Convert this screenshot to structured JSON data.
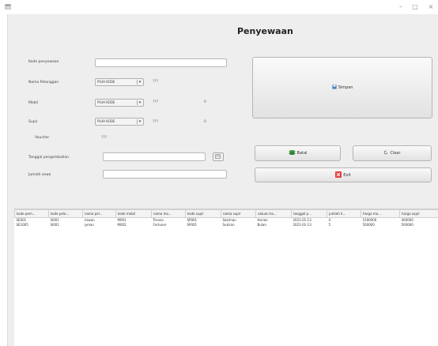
{
  "window": {
    "minimize": "–",
    "maximize": "□",
    "close": "×"
  },
  "form": {
    "title": "Penyewaan",
    "kode_penyewaan": {
      "label": "Kode penyewaan",
      "value": ""
    },
    "nama_pelanggan": {
      "label": "Nama Pelanggan",
      "selected": "PILIH KODE",
      "value": "???"
    },
    "mobil": {
      "label": "Mobil",
      "selected": "PILIH KODE",
      "value": "???",
      "extra": "0"
    },
    "supir": {
      "label": "Supir",
      "selected": "PILIH KODE",
      "value": "???",
      "extra": "0"
    },
    "voucher": {
      "label": "Voucher",
      "value": "???"
    },
    "tanggal_pengembalian": {
      "label": "Tanggal pengembalian",
      "value": ""
    },
    "jumlah_sewa": {
      "label": "Jumlah sewa",
      "value": ""
    }
  },
  "buttons": {
    "simpan": "Simpan",
    "batal": "Batal",
    "clear": "Clear",
    "exit": "Exit"
  },
  "colors": {
    "window_bg": "#eeeeee",
    "exit_icon": "#e04040",
    "batal_icon": "#3a9a3a",
    "simpan_icon": "#4a7fc0"
  },
  "table": {
    "columns": [
      "kode pem...",
      "kode pela...",
      "nama pel...",
      "kode mobil",
      "nama mo...",
      "kode supir",
      "nama supir",
      "satuan ha...",
      "tanggal p...",
      "jumlah h...",
      "harga mo...",
      "harga supir"
    ],
    "rows": [
      [
        "SE001",
        "SI001",
        "rizwan",
        "M001",
        "Terano",
        "SP001",
        "Sakiman",
        "Harian",
        "2021-01-13",
        "4",
        "1500000",
        "400000"
      ],
      [
        "SE1005",
        "SI001",
        "iyman",
        "M002",
        "Fortuner",
        "SP001",
        "Sukiran",
        "Bulan",
        "2021-01-13",
        "5",
        "500000",
        "500000"
      ]
    ]
  }
}
